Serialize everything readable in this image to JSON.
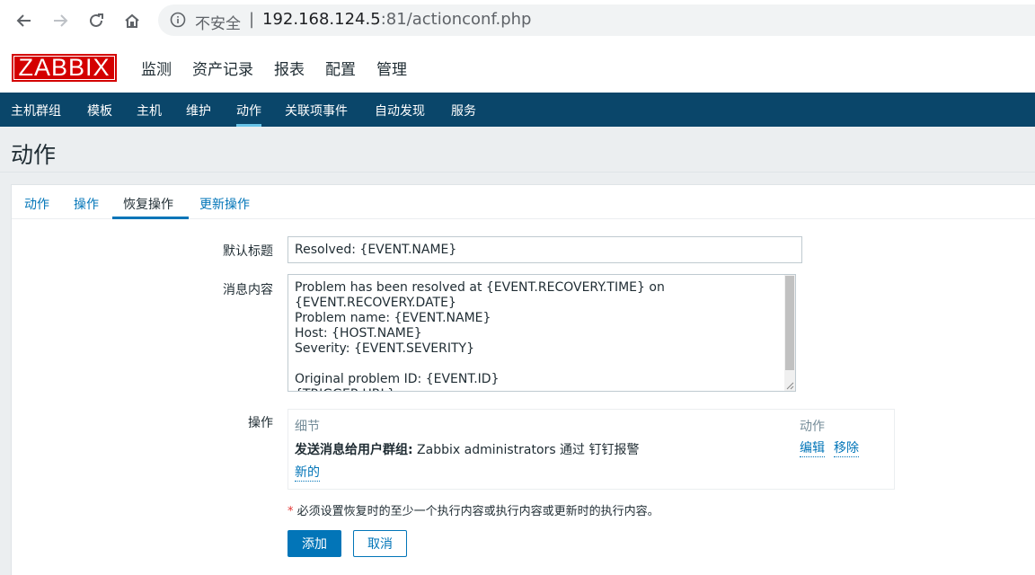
{
  "browser": {
    "security_label": "不安全",
    "separator": "|",
    "url_host": "192.168.124.5",
    "url_rest": ":81/actionconf.php"
  },
  "header": {
    "logo": "ZABBIX",
    "menu": [
      "监测",
      "资产记录",
      "报表",
      "配置",
      "管理"
    ],
    "active_menu": "配置"
  },
  "sub_nav": {
    "items": [
      "主机群组",
      "模板",
      "主机",
      "维护",
      "动作",
      "关联项事件",
      "自动发现",
      "服务"
    ],
    "active": "动作"
  },
  "page_title": "动作",
  "tabs": [
    "动作",
    "操作",
    "恢复操作",
    "更新操作"
  ],
  "active_tab": "恢复操作",
  "form": {
    "subject_label": "默认标题",
    "subject_value": "Resolved: {EVENT.NAME}",
    "message_label": "消息内容",
    "message_value": "Problem has been resolved at {EVENT.RECOVERY.TIME} on\n{EVENT.RECOVERY.DATE}\nProblem name: {EVENT.NAME}\nHost: {HOST.NAME}\nSeverity: {EVENT.SEVERITY}\n\nOriginal problem ID: {EVENT.ID}\n{TRIGGER.URL}",
    "operations_label": "操作",
    "operations": {
      "col_details": "细节",
      "col_action": "动作",
      "row_bold": "发送消息给用户群组:",
      "row_text": " Zabbix administrators 通过 钉钉报警",
      "edit_link": "编辑",
      "remove_link": "移除",
      "new_link": "新的"
    },
    "note_star": "*",
    "note_text": " 必须设置恢复时的至少一个执行内容或执行内容或更新时的执行内容。",
    "add_button": "添加",
    "cancel_button": "取消"
  }
}
